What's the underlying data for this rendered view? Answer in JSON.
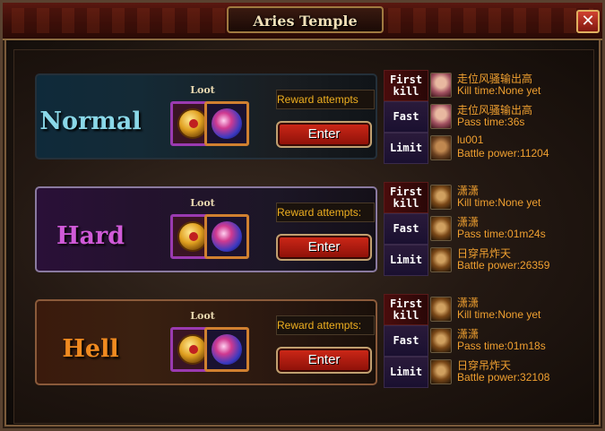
{
  "window": {
    "title": "Aries Temple",
    "close_label": "✕"
  },
  "loot_label": "Loot",
  "enter_label": "Enter",
  "difficulties": [
    {
      "name": "Normal",
      "reward_label": "Reward attempts",
      "records": [
        {
          "tag": "First kill",
          "player": "走位风骚输出高",
          "detail": "Kill time:None yet",
          "avatar": "female-portrait"
        },
        {
          "tag": "Fast",
          "player": "走位风骚输出高",
          "detail": "Pass time:36s",
          "avatar": "female-portrait"
        },
        {
          "tag": "Limit",
          "player": "lu001",
          "detail": "Battle power:11204",
          "avatar": "male-portrait"
        }
      ]
    },
    {
      "name": "Hard",
      "reward_label": "Reward attempts:",
      "records": [
        {
          "tag": "First kill",
          "player": "潇潇",
          "detail": "Kill time:None yet",
          "avatar": "warrior-portrait"
        },
        {
          "tag": "Fast",
          "player": "潇潇",
          "detail": "Pass time:01m24s",
          "avatar": "warrior-portrait"
        },
        {
          "tag": "Limit",
          "player": "日穿吊炸天",
          "detail": "Battle power:26359",
          "avatar": "warrior-portrait"
        }
      ]
    },
    {
      "name": "Hell",
      "reward_label": "Reward attempts:",
      "records": [
        {
          "tag": "First kill",
          "player": "潇潇",
          "detail": "Kill time:None yet",
          "avatar": "warrior-portrait"
        },
        {
          "tag": "Fast",
          "player": "潇潇",
          "detail": "Pass time:01m18s",
          "avatar": "warrior-portrait"
        },
        {
          "tag": "Limit",
          "player": "日穿吊炸天",
          "detail": "Battle power:32108",
          "avatar": "warrior-portrait"
        }
      ]
    }
  ],
  "colors": {
    "accent_gold": "#f0a030",
    "enter_red": "#c02010",
    "title_cream": "#f2e0b8"
  }
}
